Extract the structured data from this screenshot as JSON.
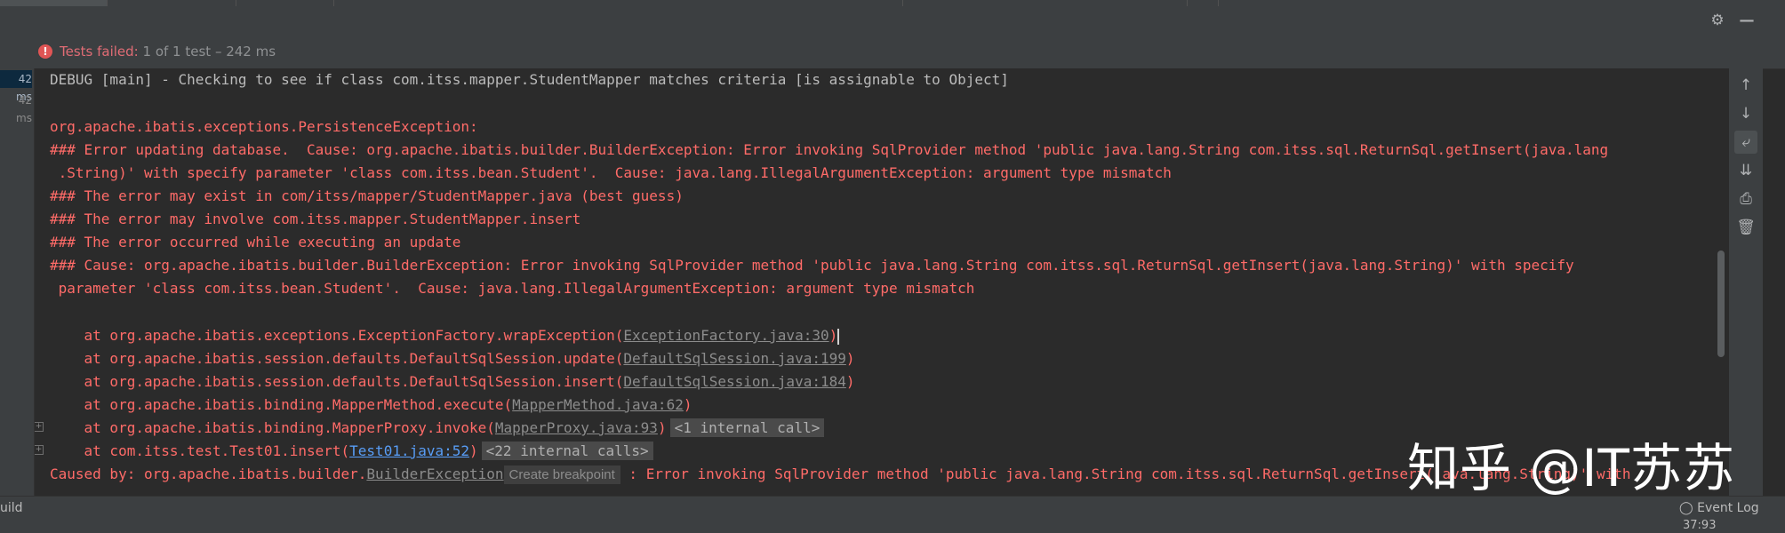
{
  "status": {
    "label": "Tests failed:",
    "detail": "1 of 1 test – 242 ms"
  },
  "times": [
    "42 ms",
    "42 ms"
  ],
  "console": {
    "debug": "DEBUG [main] - Checking to see if class com.itss.mapper.StudentMapper matches criteria [is assignable to Object]",
    "e1": "org.apache.ibatis.exceptions.PersistenceException:",
    "e2": "### Error updating database.  Cause: org.apache.ibatis.builder.BuilderException: Error invoking SqlProvider method 'public java.lang.String com.itss.sql.ReturnSql.getInsert(java.lang",
    "e3": " .String)' with specify parameter 'class com.itss.bean.Student'.  Cause: java.lang.IllegalArgumentException: argument type mismatch",
    "e4": "### The error may exist in com/itss/mapper/StudentMapper.java (best guess)",
    "e5": "### The error may involve com.itss.mapper.StudentMapper.insert",
    "e6": "### The error occurred while executing an update",
    "e7": "### Cause: org.apache.ibatis.builder.BuilderException: Error invoking SqlProvider method 'public java.lang.String com.itss.sql.ReturnSql.getInsert(java.lang.String)' with specify",
    "e8": " parameter 'class com.itss.bean.Student'.  Cause: java.lang.IllegalArgumentException: argument type mismatch",
    "stack": [
      {
        "prefix": "    at org.apache.ibatis.exceptions.ExceptionFactory.wrapException(",
        "link": "ExceptionFactory.java:30",
        "suffix": ")"
      },
      {
        "prefix": "    at org.apache.ibatis.session.defaults.DefaultSqlSession.update(",
        "link": "DefaultSqlSession.java:199",
        "suffix": ")"
      },
      {
        "prefix": "    at org.apache.ibatis.session.defaults.DefaultSqlSession.insert(",
        "link": "DefaultSqlSession.java:184",
        "suffix": ")"
      },
      {
        "prefix": "    at org.apache.ibatis.binding.MapperMethod.execute(",
        "link": "MapperMethod.java:62",
        "suffix": ")"
      },
      {
        "prefix": "    at org.apache.ibatis.binding.MapperProxy.invoke(",
        "link": "MapperProxy.java:93",
        "suffix": ")",
        "hint": "<1 internal call>"
      },
      {
        "prefix": "    at com.itss.test.Test01.insert(",
        "link": "Test01.java:52",
        "suffix": ")",
        "hint": "<22 internal calls>"
      }
    ],
    "caused_prefix": "Caused by: org.apache.ibatis.builder.",
    "caused_link": "BuilderException",
    "create_breakpoint": "Create breakpoint",
    "caused_rest": " : Error invoking SqlProvider method 'public java.lang.String com.itss.sql.ReturnSql.getInsert(java.lang.String)' with"
  },
  "bottom": {
    "build": "uild",
    "event_log": "Event Log",
    "position": "37:93"
  },
  "watermark": "知乎 @IT苏苏",
  "icons": {
    "settings": "gear-icon",
    "minimize": "minimize-icon",
    "error": "error-icon",
    "up": "arrow-up-icon",
    "down": "arrow-down-icon",
    "wrap": "soft-wrap-icon",
    "scroll_end": "scroll-to-end-icon",
    "print": "print-icon",
    "trash": "trash-icon"
  }
}
